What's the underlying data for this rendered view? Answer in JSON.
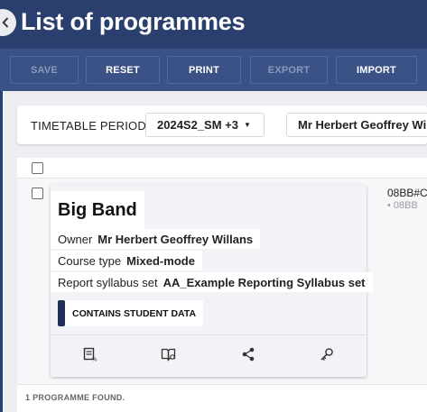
{
  "header": {
    "title": "List of programmes"
  },
  "toolbar": {
    "save": "SAVE",
    "reset": "RESET",
    "print": "PRINT",
    "export": "EXPORT",
    "import": "IMPORT"
  },
  "filters": {
    "timetable_label": "TIMETABLE PERIOD",
    "period_value": "2024S2_SM +3",
    "owner_value": "Mr Herbert Geoffrey Willans"
  },
  "programme": {
    "title": "Big Band",
    "owner_label": "Owner",
    "owner_value": "Mr Herbert Geoffrey Willans",
    "course_type_label": "Course type",
    "course_type_value": "Mixed-mode",
    "syllabus_label": "Report syllabus set",
    "syllabus_value": "AA_Example Reporting Syllabus set",
    "badge": "CONTAINS STUDENT DATA",
    "code": "08BB#C",
    "sub_item": "08BB"
  },
  "footer": {
    "count_text": "1 PROGRAMME FOUND."
  },
  "colors": {
    "header_bg": "#2b3f6e",
    "toolbar_bg": "#3b5287",
    "badge_accent": "#1f2f55"
  },
  "icons": [
    "back-chevron-icon",
    "caret-down-icon",
    "report-percent-icon",
    "book-view-icon",
    "share-icon",
    "key-icon"
  ]
}
